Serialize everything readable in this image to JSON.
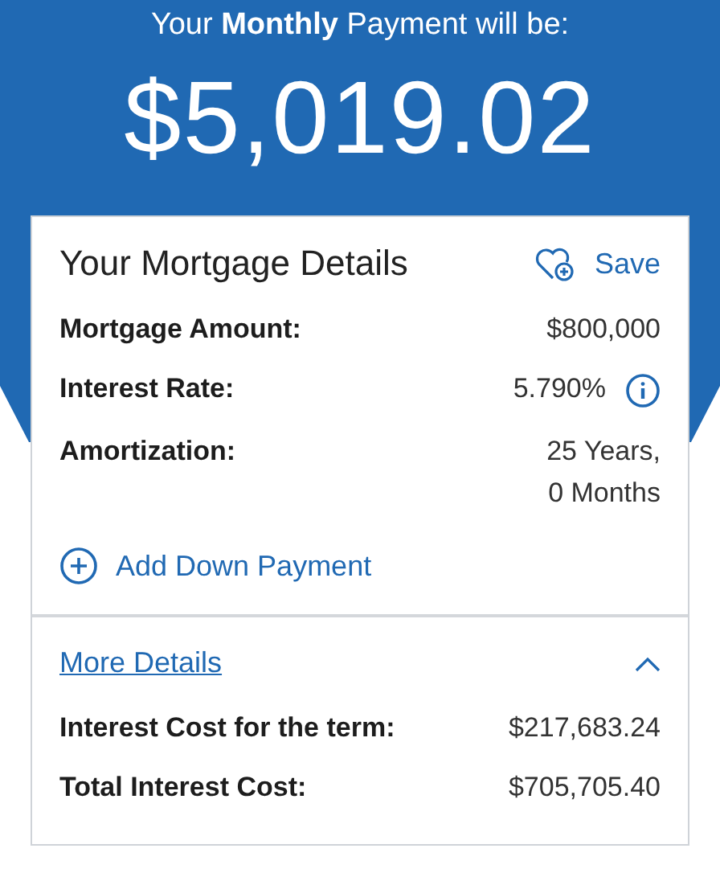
{
  "header": {
    "caption": "Your **Monthly** Payment will be:",
    "amount": "$5,019.02"
  },
  "card": {
    "title": "Your Mortgage Details",
    "save_label": "Save",
    "rows": [
      {
        "label": "Mortgage Amount:",
        "kind": "plain",
        "value_lines": [
          "$800,000"
        ]
      },
      {
        "label": "Interest Rate:",
        "kind": "info",
        "value_lines": [
          "5.790%"
        ]
      },
      {
        "label": "Amortization:",
        "kind": "plain",
        "value_lines": [
          "25 Years,",
          "0 Months"
        ]
      }
    ],
    "add_link": "Add Down Payment",
    "more": {
      "label": "More Details",
      "expanded": true,
      "rows": [
        {
          "label": "Interest Cost for the term:",
          "value": "$217,683.24"
        },
        {
          "label": "Total Interest Cost:",
          "value": "$705,705.40"
        }
      ]
    }
  }
}
